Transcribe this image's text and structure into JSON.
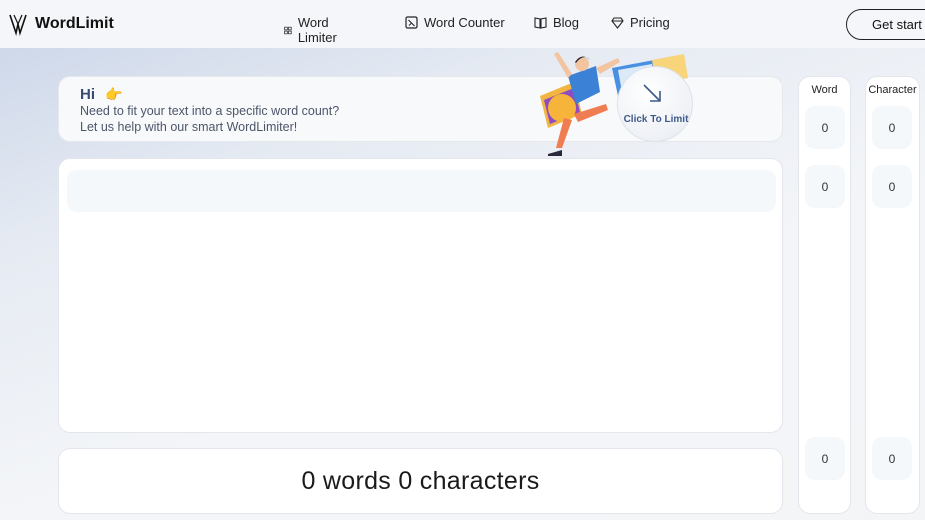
{
  "header": {
    "logo_text": "WordLimit",
    "nav": [
      {
        "label": "Word Limiter",
        "icon": "grid-icon"
      },
      {
        "label": "Word Counter",
        "icon": "counter-icon"
      },
      {
        "label": "Blog",
        "icon": "book-icon"
      },
      {
        "label": "Pricing",
        "icon": "gem-icon"
      }
    ],
    "cta_label": "Get start"
  },
  "hero": {
    "greeting": "Hi",
    "line1": "Need to fit your text into a specific word count?",
    "line2": "Let us help with our smart WordLimiter!",
    "click_label": "Click To Limit"
  },
  "result": {
    "text": "0 words 0 characters"
  },
  "columns": {
    "word_header": "Word",
    "char_header": "Character",
    "word_values": [
      "0",
      "0",
      "0"
    ],
    "char_values": [
      "0",
      "0",
      "0"
    ]
  },
  "colors": {
    "accent": "#3f5a8a",
    "panel": "#f4f8fb",
    "border": "#e3e6ec"
  }
}
